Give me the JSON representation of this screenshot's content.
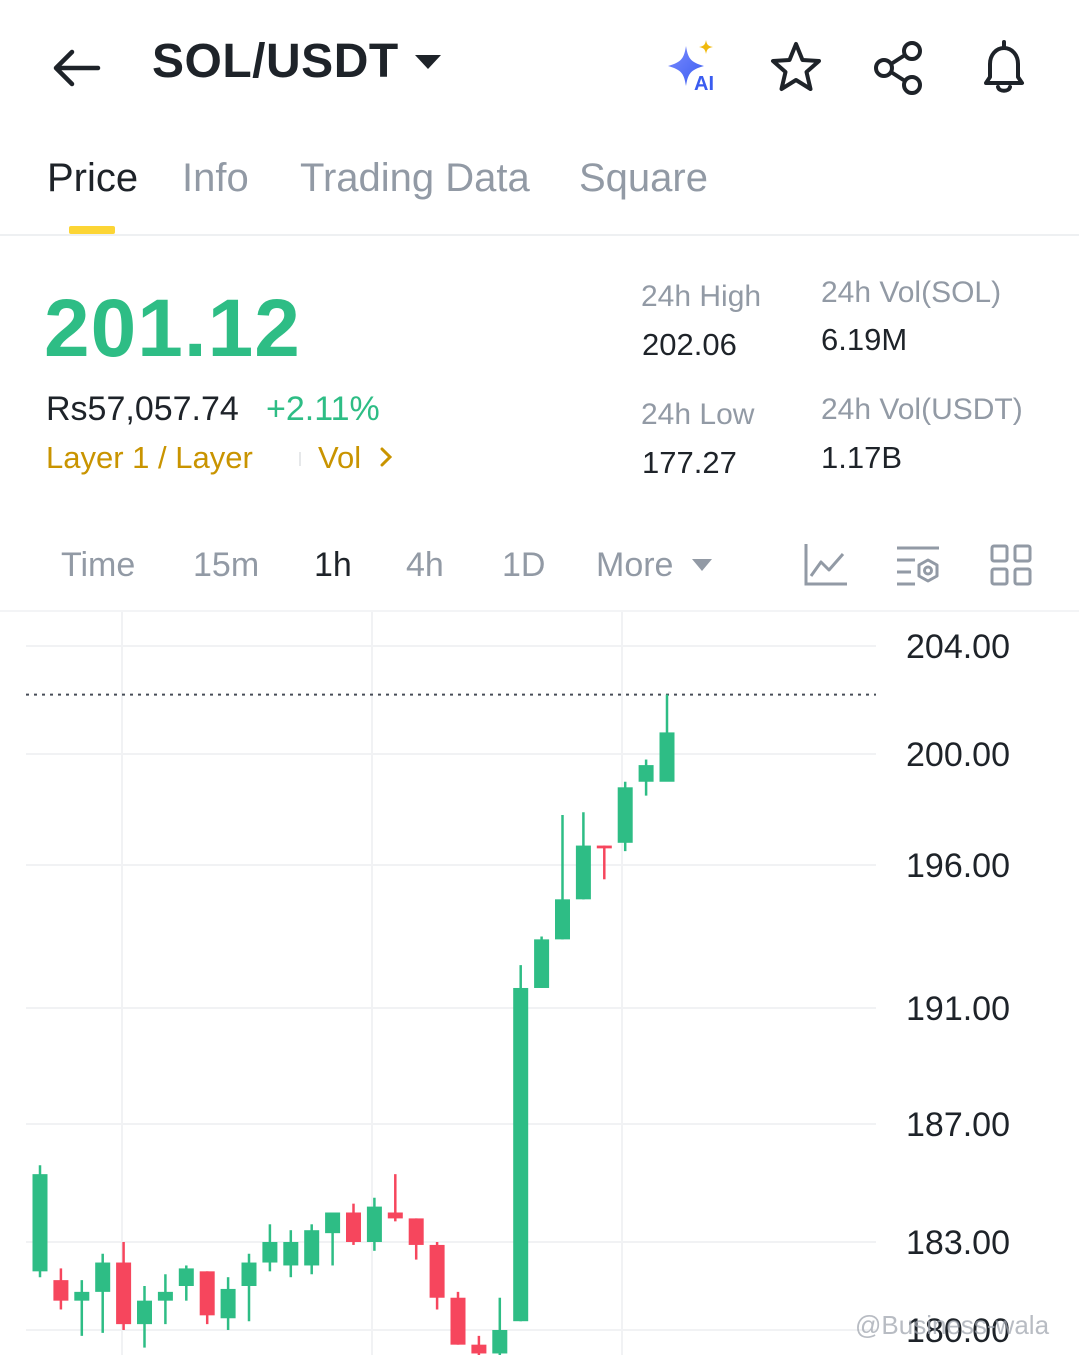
{
  "header": {
    "pair_title": "SOL/USDT",
    "icons": [
      "back-arrow-icon",
      "ai-sparkle-icon",
      "star-icon",
      "share-icon",
      "bell-icon"
    ],
    "ai_badge": "AI"
  },
  "tabs": [
    {
      "label": "Price",
      "active": true
    },
    {
      "label": "Info",
      "active": false
    },
    {
      "label": "Trading Data",
      "active": false
    },
    {
      "label": "Square",
      "active": false
    }
  ],
  "ticker": {
    "last_price": "201.12",
    "inr_price": "Rs57,057.74",
    "change_pct": "+2.11%",
    "tag_category": "Layer 1 / Layer",
    "tag_vol": "Vol",
    "high_label": "24h High",
    "high_value": "202.06",
    "low_label": "24h Low",
    "low_value": "177.27",
    "vol_base_label": "24h Vol(SOL)",
    "vol_base_value": "6.19M",
    "vol_quote_label": "24h Vol(USDT)",
    "vol_quote_value": "1.17B"
  },
  "intervals": [
    {
      "label": "Time",
      "active": false
    },
    {
      "label": "15m",
      "active": false
    },
    {
      "label": "1h",
      "active": true
    },
    {
      "label": "4h",
      "active": false
    },
    {
      "label": "1D",
      "active": false
    },
    {
      "label": "More",
      "active": false
    }
  ],
  "toolbar_icons": [
    "line-chart-icon",
    "indicator-settings-icon",
    "grid-layout-icon"
  ],
  "colors": {
    "up": "#2ebd85",
    "down": "#f6465d",
    "accent": "#fcd535",
    "tag": "#c99400",
    "muted": "#929aa5",
    "text": "#1e2329"
  },
  "watermark": "@Business-wala",
  "chart_data": {
    "type": "candlestick",
    "y_tick_labels": [
      "204.00",
      "200.00",
      "196.00",
      "191.00",
      "187.00",
      "183.00",
      "180.00"
    ],
    "y_tick_values": [
      204.0,
      200.0,
      196.0,
      191.0,
      187.0,
      183.0,
      180.0
    ],
    "last_price_line": 202.2,
    "candles": [
      {
        "o": 182.0,
        "h": 185.6,
        "l": 181.8,
        "c": 185.3
      },
      {
        "o": 181.7,
        "h": 182.1,
        "l": 180.7,
        "c": 181.0
      },
      {
        "o": 181.0,
        "h": 181.7,
        "l": 179.8,
        "c": 181.3
      },
      {
        "o": 181.3,
        "h": 182.6,
        "l": 179.9,
        "c": 182.3
      },
      {
        "o": 182.3,
        "h": 183.0,
        "l": 180.0,
        "c": 180.2
      },
      {
        "o": 180.2,
        "h": 181.5,
        "l": 179.4,
        "c": 181.0
      },
      {
        "o": 181.0,
        "h": 181.9,
        "l": 180.2,
        "c": 181.3
      },
      {
        "o": 181.5,
        "h": 182.2,
        "l": 181.0,
        "c": 182.1
      },
      {
        "o": 182.0,
        "h": 182.0,
        "l": 180.2,
        "c": 180.5
      },
      {
        "o": 180.4,
        "h": 181.8,
        "l": 180.0,
        "c": 181.4
      },
      {
        "o": 181.5,
        "h": 182.6,
        "l": 180.3,
        "c": 182.3
      },
      {
        "o": 182.3,
        "h": 183.6,
        "l": 182.0,
        "c": 183.0
      },
      {
        "o": 182.2,
        "h": 183.4,
        "l": 181.8,
        "c": 183.0
      },
      {
        "o": 182.2,
        "h": 183.6,
        "l": 181.9,
        "c": 183.4
      },
      {
        "o": 183.3,
        "h": 184.0,
        "l": 182.2,
        "c": 184.0
      },
      {
        "o": 184.0,
        "h": 184.3,
        "l": 182.9,
        "c": 183.0
      },
      {
        "o": 183.0,
        "h": 184.5,
        "l": 182.7,
        "c": 184.2
      },
      {
        "o": 184.0,
        "h": 185.3,
        "l": 183.7,
        "c": 183.8
      },
      {
        "o": 183.8,
        "h": 183.8,
        "l": 182.4,
        "c": 182.9
      },
      {
        "o": 182.9,
        "h": 183.0,
        "l": 180.7,
        "c": 181.1
      },
      {
        "o": 181.1,
        "h": 181.3,
        "l": 179.5,
        "c": 179.5
      },
      {
        "o": 179.5,
        "h": 179.8,
        "l": 179.0,
        "c": 179.2
      },
      {
        "o": 179.2,
        "h": 181.1,
        "l": 179.0,
        "c": 180.0
      },
      {
        "o": 180.3,
        "h": 192.5,
        "l": 180.3,
        "c": 191.7
      },
      {
        "o": 191.7,
        "h": 193.5,
        "l": 191.7,
        "c": 193.4
      },
      {
        "o": 193.4,
        "h": 197.8,
        "l": 193.4,
        "c": 194.8
      },
      {
        "o": 194.8,
        "h": 197.9,
        "l": 194.8,
        "c": 196.7
      },
      {
        "o": 196.7,
        "h": 196.7,
        "l": 195.5,
        "c": 196.6
      },
      {
        "o": 196.8,
        "h": 199.0,
        "l": 196.5,
        "c": 198.8
      },
      {
        "o": 199.0,
        "h": 199.8,
        "l": 198.5,
        "c": 199.6
      },
      {
        "o": 199.0,
        "h": 202.2,
        "l": 199.2,
        "c": 200.8
      }
    ]
  }
}
